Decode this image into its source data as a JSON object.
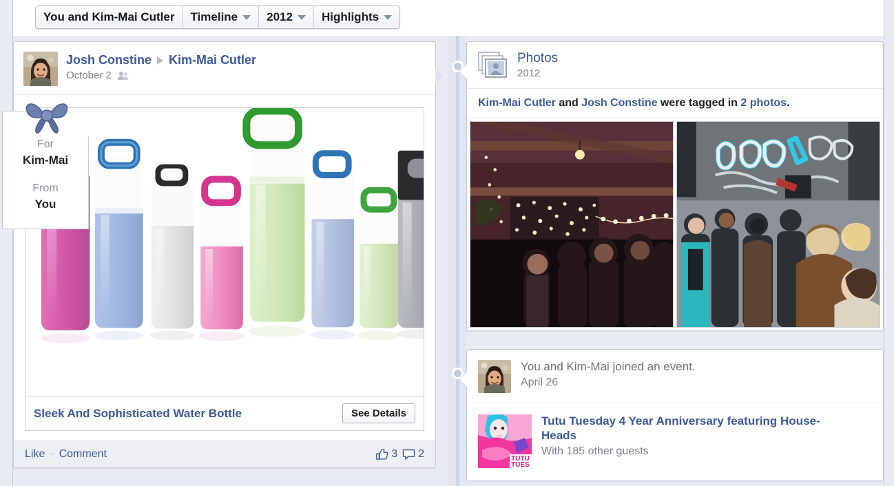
{
  "toolbar": {
    "title": "You and Kim-Mai Cutler",
    "buttons": [
      {
        "label": "Timeline",
        "caret": "chevron-down-icon"
      },
      {
        "label": "2012",
        "caret": "chevron-down-icon"
      },
      {
        "label": "Highlights",
        "caret": "chevron-down-icon"
      }
    ]
  },
  "left_story": {
    "author": "Josh Constine",
    "target": "Kim-Mai Cutler",
    "date": "October 2",
    "privacy_icon": "friends-icon",
    "gift_tag": {
      "for_label": "For",
      "for_name": "Kim-Mai",
      "from_label": "From",
      "from_name": "You",
      "bow_icon": "gift-bow-icon"
    },
    "product_title": "Sleek And Sophisticated Water Bottle",
    "see_details": "See Details",
    "footer": {
      "like": "Like",
      "separator": "·",
      "comment": "Comment",
      "like_icon": "thumbs-up-icon",
      "like_count": "3",
      "comment_icon": "comment-bubble-icon",
      "comment_count": "2"
    }
  },
  "photos_card": {
    "icon": "photos-stack-icon",
    "title": "Photos",
    "year": "2012",
    "tagline": {
      "person1": "Kim-Mai Cutler",
      "and": " and ",
      "person2": "Josh Constine",
      "middle": " were tagged in ",
      "link": "2 photos",
      "period": "."
    },
    "photos": [
      {
        "name": "photo-warehouse-party",
        "alt": "Indoor party with string lights"
      },
      {
        "name": "photo-street-party",
        "alt": "Outdoor street crowd with graffiti wall"
      }
    ]
  },
  "event_card": {
    "joined_text": "You and Kim-Mai joined an event.",
    "joined_date": "April 26",
    "event_title": "Tutu Tuesday 4 Year Anniversary featuring House-Heads",
    "event_guests": "With 185 other guests",
    "event_thumb": "tutu-tuesday-thumbnail"
  },
  "colors": {
    "link": "#3b5998",
    "spine": "#ccd4e6",
    "page_bg": "#e9ebf2",
    "card_bg": "#ffffff",
    "muted_text": "#7b7f87"
  }
}
